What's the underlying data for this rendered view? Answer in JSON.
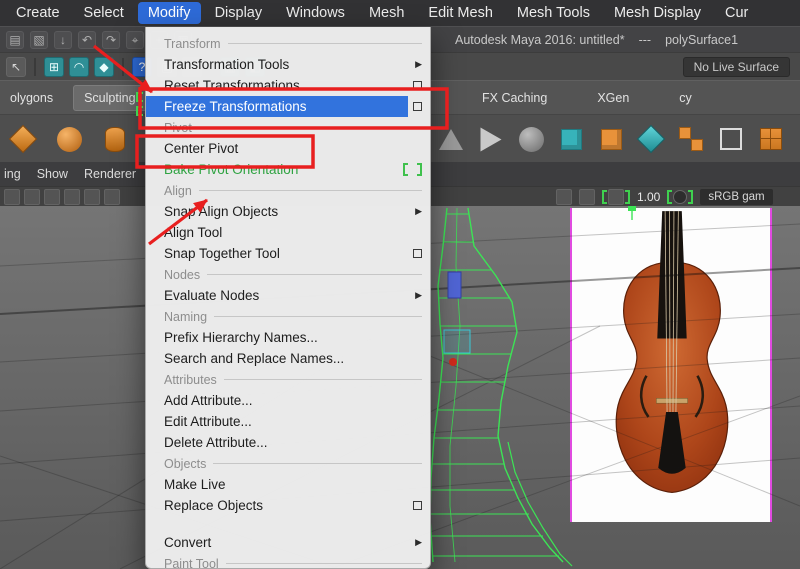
{
  "colors": {
    "menu_highlight": "#3273dd",
    "annotation_red": "#e81f1f",
    "new_feature_green": "#3fc14d",
    "image_plane_edge": "#e04ae0",
    "wireframe_green": "#3ce455"
  },
  "icons": {
    "submenu_arrow": "▶"
  },
  "menubar": {
    "items": [
      {
        "label": "Create"
      },
      {
        "label": "Select"
      },
      {
        "label": "Modify",
        "active": true
      },
      {
        "label": "Display"
      },
      {
        "label": "Windows"
      },
      {
        "label": "Mesh"
      },
      {
        "label": "Edit Mesh"
      },
      {
        "label": "Mesh Tools"
      },
      {
        "label": "Mesh Display"
      },
      {
        "label": "Cur"
      }
    ]
  },
  "titlebar": {
    "app": "Autodesk Maya 2016: untitled*",
    "separator": "---",
    "selection": "polySurface1"
  },
  "statusline": {
    "live_surface": "No Live Surface"
  },
  "shelf": {
    "tabs_left": [
      {
        "label": "olygons"
      },
      {
        "label": "Sculpting"
      }
    ],
    "tabs_right": [
      {
        "label": "FX Caching"
      },
      {
        "label": "XGen"
      },
      {
        "label": "cy"
      }
    ]
  },
  "viewport_bar": {
    "words": [
      "ing",
      "Show",
      "Renderer"
    ],
    "exposure": "1.00",
    "colorspace": "sRGB gam"
  },
  "modify_menu": {
    "items": [
      {
        "type": "header",
        "label": "Transform"
      },
      {
        "type": "item",
        "label": "Transformation Tools",
        "submenu": true
      },
      {
        "type": "item",
        "label": "Reset Transformations",
        "optionbox": true
      },
      {
        "type": "item",
        "label": "Freeze Transformations",
        "optionbox": true,
        "highlighted": true
      },
      {
        "type": "header",
        "label": "Pivot"
      },
      {
        "type": "item",
        "label": "Center Pivot"
      },
      {
        "type": "item",
        "label": "Bake Pivot Orientation",
        "new_feature": true
      },
      {
        "type": "header",
        "label": "Align"
      },
      {
        "type": "item",
        "label": "Snap Align Objects",
        "submenu": true
      },
      {
        "type": "item",
        "label": "Align Tool"
      },
      {
        "type": "item",
        "label": "Snap Together Tool",
        "optionbox": true
      },
      {
        "type": "header",
        "label": "Nodes"
      },
      {
        "type": "item",
        "label": "Evaluate Nodes",
        "submenu": true
      },
      {
        "type": "header",
        "label": "Naming"
      },
      {
        "type": "item",
        "label": "Prefix Hierarchy Names..."
      },
      {
        "type": "item",
        "label": "Search and Replace Names..."
      },
      {
        "type": "header",
        "label": "Attributes"
      },
      {
        "type": "item",
        "label": "Add Attribute..."
      },
      {
        "type": "item",
        "label": "Edit Attribute..."
      },
      {
        "type": "item",
        "label": "Delete Attribute..."
      },
      {
        "type": "header",
        "label": "Objects"
      },
      {
        "type": "item",
        "label": "Make Live"
      },
      {
        "type": "item",
        "label": "Replace Objects",
        "optionbox": true
      },
      {
        "type": "item",
        "label": "Convert",
        "submenu": true
      },
      {
        "type": "header",
        "label": "Paint Tool"
      }
    ]
  },
  "annotations": {
    "highlighted_items": [
      "Freeze Transformations",
      "Center Pivot"
    ],
    "arrow_count": 2
  }
}
